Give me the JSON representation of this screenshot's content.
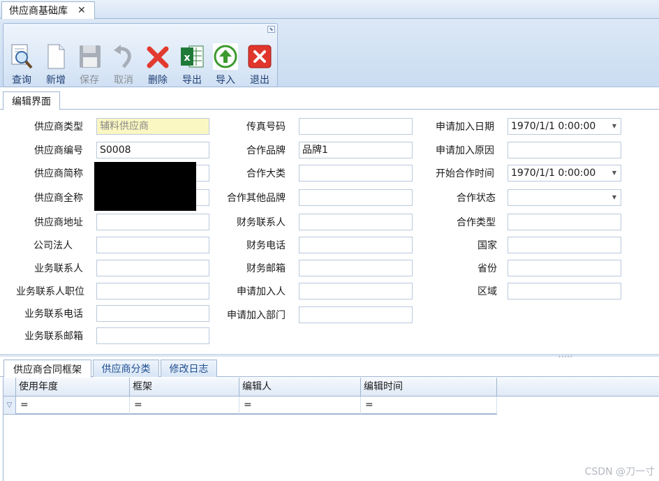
{
  "window": {
    "tab_title": "供应商基础库",
    "tab_close": "✕"
  },
  "toolbar": {
    "launcher": "⬊",
    "buttons": [
      {
        "id": "query",
        "label": "查询",
        "icon": "magnifier-document-icon",
        "enabled": true
      },
      {
        "id": "new",
        "label": "新增",
        "icon": "blank-document-icon",
        "enabled": true
      },
      {
        "id": "save",
        "label": "保存",
        "icon": "floppy-disk-icon",
        "enabled": false
      },
      {
        "id": "cancel",
        "label": "取消",
        "icon": "undo-arrow-icon",
        "enabled": false
      },
      {
        "id": "delete",
        "label": "删除",
        "icon": "red-x-icon",
        "enabled": true
      },
      {
        "id": "export",
        "label": "导出",
        "icon": "excel-icon",
        "enabled": true
      },
      {
        "id": "import",
        "label": "导入",
        "icon": "green-up-arrow-icon",
        "enabled": true
      },
      {
        "id": "exit",
        "label": "退出",
        "icon": "red-close-box-icon",
        "enabled": true
      }
    ]
  },
  "edit_tab": {
    "label": "编辑界面"
  },
  "form": {
    "col1": [
      {
        "label": "供应商类型",
        "value": "辅料供应商"
      },
      {
        "label": "供应商编号",
        "value": "S0008"
      },
      {
        "label": "供应商简称",
        "value": ""
      },
      {
        "label": "供应商全称",
        "value": ""
      },
      {
        "label": "供应商地址",
        "value": ""
      },
      {
        "label": "公司法人",
        "value": ""
      },
      {
        "label": "业务联系人",
        "value": ""
      },
      {
        "label": "业务联系人职位",
        "value": ""
      },
      {
        "label": "业务联系电话",
        "value": ""
      },
      {
        "label": "业务联系邮箱",
        "value": ""
      }
    ],
    "col2": [
      {
        "label": "传真号码",
        "value": ""
      },
      {
        "label": "合作品牌",
        "value": "品牌1"
      },
      {
        "label": "合作大类",
        "value": ""
      },
      {
        "label": "合作其他品牌",
        "value": ""
      },
      {
        "label": "财务联系人",
        "value": ""
      },
      {
        "label": "财务电话",
        "value": ""
      },
      {
        "label": "财务邮箱",
        "value": ""
      },
      {
        "label": "申请加入人",
        "value": ""
      },
      {
        "label": "申请加入部门",
        "value": ""
      }
    ],
    "col3": [
      {
        "label": "申请加入日期",
        "value": "1970/1/1 0:00:00",
        "dropdown": true
      },
      {
        "label": "申请加入原因",
        "value": ""
      },
      {
        "label": "开始合作时间",
        "value": "1970/1/1 0:00:00",
        "dropdown": true
      },
      {
        "label": "合作状态",
        "value": "",
        "dropdown": true
      },
      {
        "label": "合作类型",
        "value": ""
      },
      {
        "label": "国家",
        "value": ""
      },
      {
        "label": "省份",
        "value": ""
      },
      {
        "label": "区域",
        "value": ""
      }
    ]
  },
  "bottom_tabs": [
    {
      "label": "供应商合同框架",
      "active": true
    },
    {
      "label": "供应商分类",
      "active": false
    },
    {
      "label": "修改日志",
      "active": false
    }
  ],
  "grid": {
    "columns": [
      "使用年度",
      "框架",
      "编辑人",
      "编辑时间"
    ],
    "filter_row": [
      "=",
      "=",
      "=",
      "="
    ]
  },
  "watermark": "CSDN @刀一寸",
  "colors": {
    "accent": "#1f3f73",
    "yellow_field": "#fbf7c2",
    "border": "#9fb5d2"
  }
}
